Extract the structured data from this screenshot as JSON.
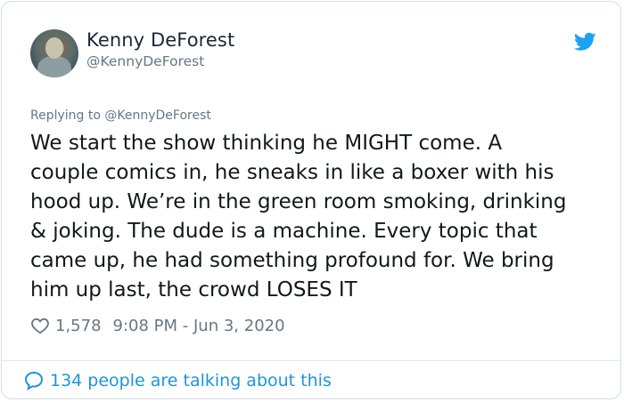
{
  "author": {
    "display_name": "Kenny DeForest",
    "handle": "@KennyDeForest"
  },
  "reply_context": "Replying to @KennyDeForest",
  "tweet": {
    "lines": [
      "We start the show thinking he MIGHT come. A",
      "couple comics in, he sneaks in like a boxer with his",
      "hood up. We’re in the green room smoking, drinking",
      "& joking. The dude is a machine. Every topic that",
      "came up, he had something profound for. We bring",
      "him up last, the crowd LOSES IT"
    ]
  },
  "meta": {
    "like_count": "1,578",
    "timestamp": "9:08 PM - Jun 3, 2020"
  },
  "footer": {
    "talking_label": "134 people are talking about this"
  },
  "colors": {
    "brand_blue": "#1da1f2",
    "link_blue": "#1b95e0",
    "secondary_text": "#657786"
  },
  "icons": [
    "avatar",
    "twitter-bird-icon",
    "heart-icon",
    "speech-bubble-icon"
  ]
}
